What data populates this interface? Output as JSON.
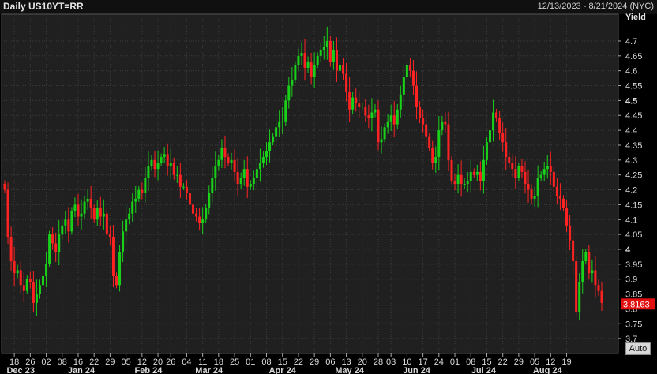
{
  "header": {
    "title": "Daily US10YT=RR",
    "date_range": "12/13/2023 - 8/21/2024 (NYC)"
  },
  "controls": {
    "auto_label": "Auto"
  },
  "colors": {
    "up": "#19d119",
    "down": "#ff2222",
    "grid": "#3c3c3c",
    "background": "#202020",
    "last_badge": "#e01010"
  },
  "chart_data": {
    "type": "candlestick",
    "title": "Daily US10YT=RR",
    "ylabel": "Yield",
    "ylim": [
      3.65,
      4.79
    ],
    "yticks": [
      3.7,
      3.75,
      3.8,
      3.85,
      3.9,
      3.95,
      4,
      4.05,
      4.1,
      4.15,
      4.2,
      4.25,
      4.3,
      4.35,
      4.4,
      4.45,
      4.5,
      4.55,
      4.6,
      4.65,
      4.7
    ],
    "ytick_labels": [
      "3.7",
      "3.75",
      "3.8",
      "3.85",
      "3.9",
      "3.95",
      "4",
      "4.05",
      "4.1",
      "4.15",
      "4.2",
      "4.25",
      "4.3",
      "4.35",
      "4.4",
      "4.45",
      "4.5",
      "4.55",
      "4.6",
      "4.65",
      "4.7"
    ],
    "bold_yticks": [
      "4",
      "4.5"
    ],
    "xticks": [
      {
        "label": "18",
        "i": 3
      },
      {
        "label": "26",
        "i": 8
      },
      {
        "label": "02",
        "i": 13
      },
      {
        "label": "08",
        "i": 18
      },
      {
        "label": "16",
        "i": 23
      },
      {
        "label": "22",
        "i": 28
      },
      {
        "label": "29",
        "i": 33
      },
      {
        "label": "05",
        "i": 38
      },
      {
        "label": "12",
        "i": 43
      },
      {
        "label": "20",
        "i": 48
      },
      {
        "label": "26",
        "i": 52
      },
      {
        "label": "04",
        "i": 57
      },
      {
        "label": "11",
        "i": 62
      },
      {
        "label": "18",
        "i": 67
      },
      {
        "label": "25",
        "i": 72
      },
      {
        "label": "01",
        "i": 77
      },
      {
        "label": "08",
        "i": 82
      },
      {
        "label": "15",
        "i": 87
      },
      {
        "label": "22",
        "i": 92
      },
      {
        "label": "29",
        "i": 97
      },
      {
        "label": "06",
        "i": 102
      },
      {
        "label": "13",
        "i": 107
      },
      {
        "label": "20",
        "i": 112
      },
      {
        "label": "28",
        "i": 117
      },
      {
        "label": "03",
        "i": 121
      },
      {
        "label": "10",
        "i": 126
      },
      {
        "label": "17",
        "i": 131
      },
      {
        "label": "24",
        "i": 136
      },
      {
        "label": "01",
        "i": 141
      },
      {
        "label": "08",
        "i": 146
      },
      {
        "label": "15",
        "i": 151
      },
      {
        "label": "22",
        "i": 156
      },
      {
        "label": "29",
        "i": 161
      },
      {
        "label": "05",
        "i": 166
      },
      {
        "label": "12",
        "i": 171
      },
      {
        "label": "19",
        "i": 176
      }
    ],
    "months": [
      {
        "label": "Dec 23",
        "i": 5
      },
      {
        "label": "Jan 24",
        "i": 24
      },
      {
        "label": "Feb 24",
        "i": 45
      },
      {
        "label": "Mar 24",
        "i": 64
      },
      {
        "label": "Apr 24",
        "i": 87
      },
      {
        "label": "May 24",
        "i": 108
      },
      {
        "label": "Jun 24",
        "i": 129
      },
      {
        "label": "Jul 24",
        "i": 150
      },
      {
        "label": "Aug 24",
        "i": 170
      }
    ],
    "last_value": "3.8163",
    "last_value_num": 3.8163,
    "close": [
      4.2,
      4.04,
      3.96,
      3.92,
      3.93,
      3.88,
      3.86,
      3.9,
      3.89,
      3.82,
      3.85,
      3.88,
      3.91,
      3.95,
      4.05,
      4.02,
      3.99,
      4.05,
      4.08,
      4.1,
      4.06,
      4.13,
      4.15,
      4.11,
      4.12,
      4.16,
      4.17,
      4.14,
      4.1,
      4.14,
      4.11,
      4.12,
      4.05,
      4.04,
      3.91,
      3.88,
      3.99,
      4.06,
      4.1,
      4.12,
      4.16,
      4.17,
      4.2,
      4.19,
      4.24,
      4.28,
      4.3,
      4.27,
      4.29,
      4.31,
      4.32,
      4.28,
      4.29,
      4.25,
      4.25,
      4.21,
      4.21,
      4.19,
      4.15,
      4.12,
      4.11,
      4.09,
      4.1,
      4.14,
      4.19,
      4.24,
      4.28,
      4.3,
      4.34,
      4.31,
      4.29,
      4.3,
      4.26,
      4.22,
      4.24,
      4.27,
      4.21,
      4.22,
      4.24,
      4.27,
      4.29,
      4.31,
      4.33,
      4.36,
      4.38,
      4.41,
      4.43,
      4.43,
      4.5,
      4.55,
      4.57,
      4.62,
      4.65,
      4.66,
      4.61,
      4.63,
      4.58,
      4.62,
      4.65,
      4.67,
      4.68,
      4.7,
      4.63,
      4.67,
      4.6,
      4.62,
      4.59,
      4.53,
      4.47,
      4.51,
      4.49,
      4.48,
      4.48,
      4.45,
      4.44,
      4.46,
      4.47,
      4.36,
      4.37,
      4.41,
      4.43,
      4.45,
      4.42,
      4.47,
      4.52,
      4.58,
      4.62,
      4.6,
      4.55,
      4.48,
      4.44,
      4.42,
      4.38,
      4.34,
      4.29,
      4.31,
      4.4,
      4.43,
      4.42,
      4.3,
      4.23,
      4.22,
      4.25,
      4.22,
      4.22,
      4.23,
      4.26,
      4.25,
      4.26,
      4.23,
      4.3,
      4.36,
      4.4,
      4.46,
      4.44,
      4.39,
      4.36,
      4.31,
      4.29,
      4.27,
      4.24,
      4.28,
      4.26,
      4.22,
      4.2,
      4.17,
      4.18,
      4.24,
      4.25,
      4.27,
      4.28,
      4.26,
      4.21,
      4.18,
      4.17,
      4.14,
      4.08,
      4.03,
      3.96,
      3.79,
      3.89,
      3.96,
      3.99,
      3.92,
      3.93,
      3.88,
      3.86,
      3.82
    ]
  }
}
